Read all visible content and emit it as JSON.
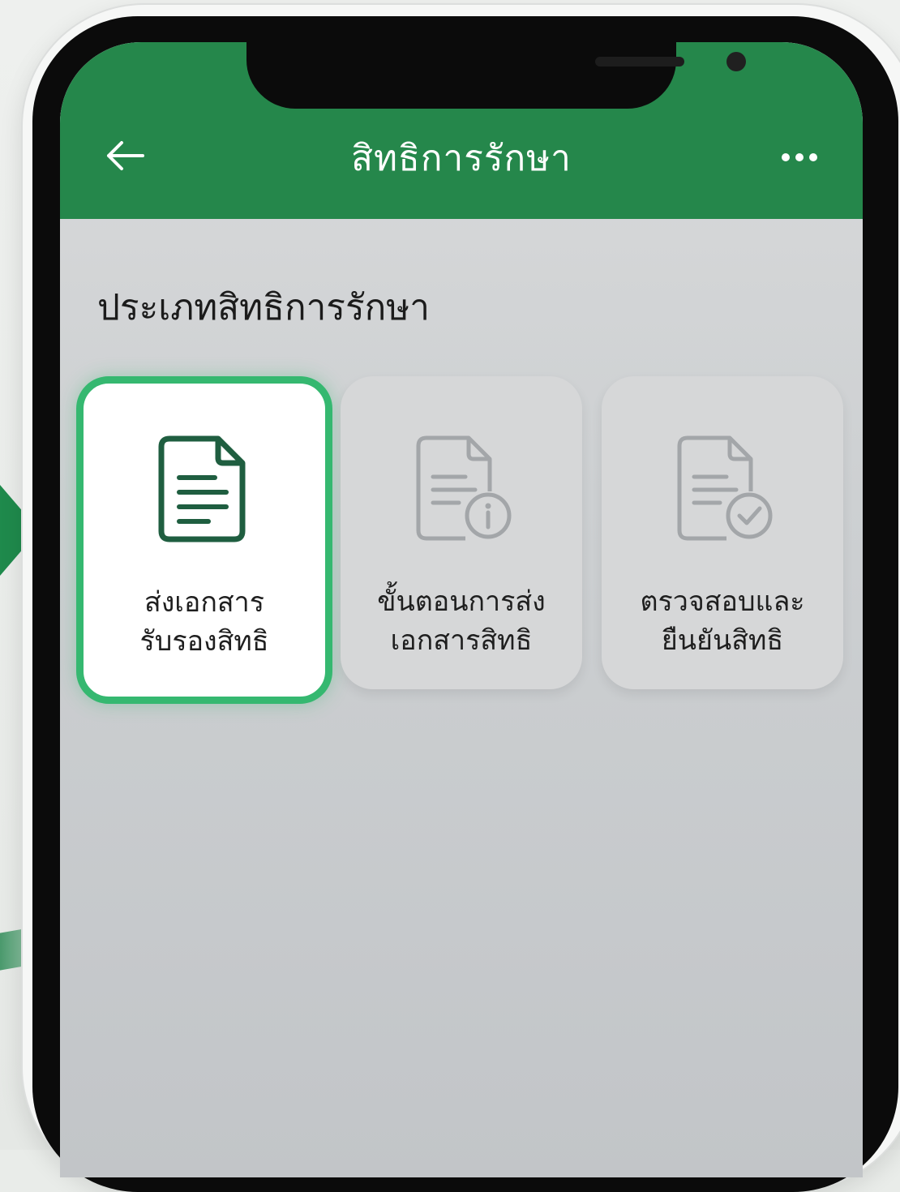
{
  "appbar": {
    "title": "สิทธิการรักษา",
    "back_icon": "arrow-left-icon",
    "more_icon": "more-horizontal-icon"
  },
  "section": {
    "heading": "ประเภทสิทธิการรักษา"
  },
  "cards": [
    {
      "label": "ส่งเอกสาร\nรับรองสิทธิ",
      "icon": "document-icon",
      "selected": true
    },
    {
      "label": "ขั้นตอนการส่ง\nเอกสารสิทธิ",
      "icon": "document-info-icon",
      "selected": false
    },
    {
      "label": "ตรวจสอบและ\nยืนยันสิทธิ",
      "icon": "document-check-icon",
      "selected": false
    }
  ],
  "colors": {
    "appbar": "#25874b",
    "accent": "#35b870",
    "icon_active": "#1f5e40",
    "icon_inactive": "#9fa3a6"
  }
}
